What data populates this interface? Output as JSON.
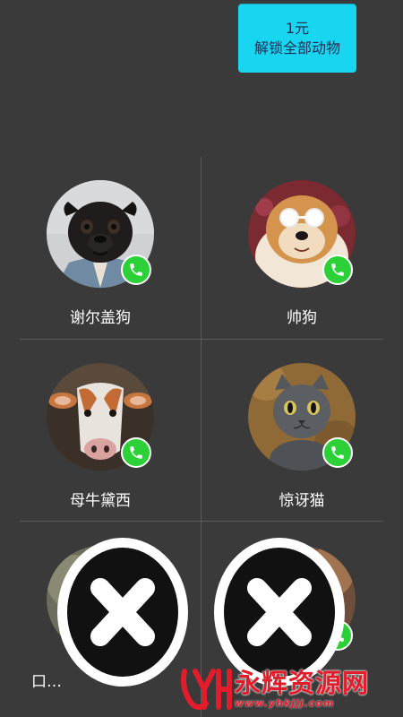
{
  "unlock": {
    "price": "1元",
    "label": "解锁全部动物",
    "color": "#19d6f0"
  },
  "animals": [
    {
      "name": "谢尔盖狗",
      "icon": "pug-photo",
      "badge": "phone-icon"
    },
    {
      "name": "帅狗",
      "icon": "fluffy-dog-sunglasses-photo",
      "badge": "phone-icon"
    },
    {
      "name": "母牛黛西",
      "icon": "cow-photo",
      "badge": "phone-icon"
    },
    {
      "name": "惊讶猫",
      "icon": "gray-cat-photo",
      "badge": "phone-icon"
    },
    {
      "name": "口…",
      "icon": "partially-hidden-animal-photo",
      "badge": "phone-icon"
    },
    {
      "name": "",
      "icon": "partially-hidden-animal-photo",
      "badge": "phone-icon"
    }
  ],
  "overlay_buttons": [
    {
      "icon": "close-icon"
    },
    {
      "icon": "close-icon"
    }
  ],
  "watermark": {
    "title": "永辉资源网",
    "url": "www.yhkjjj.com",
    "color": "#e21c2a"
  },
  "colors": {
    "background": "#3a3a3a",
    "call_badge": "#2bd136",
    "divider": "#5a5a5a"
  }
}
